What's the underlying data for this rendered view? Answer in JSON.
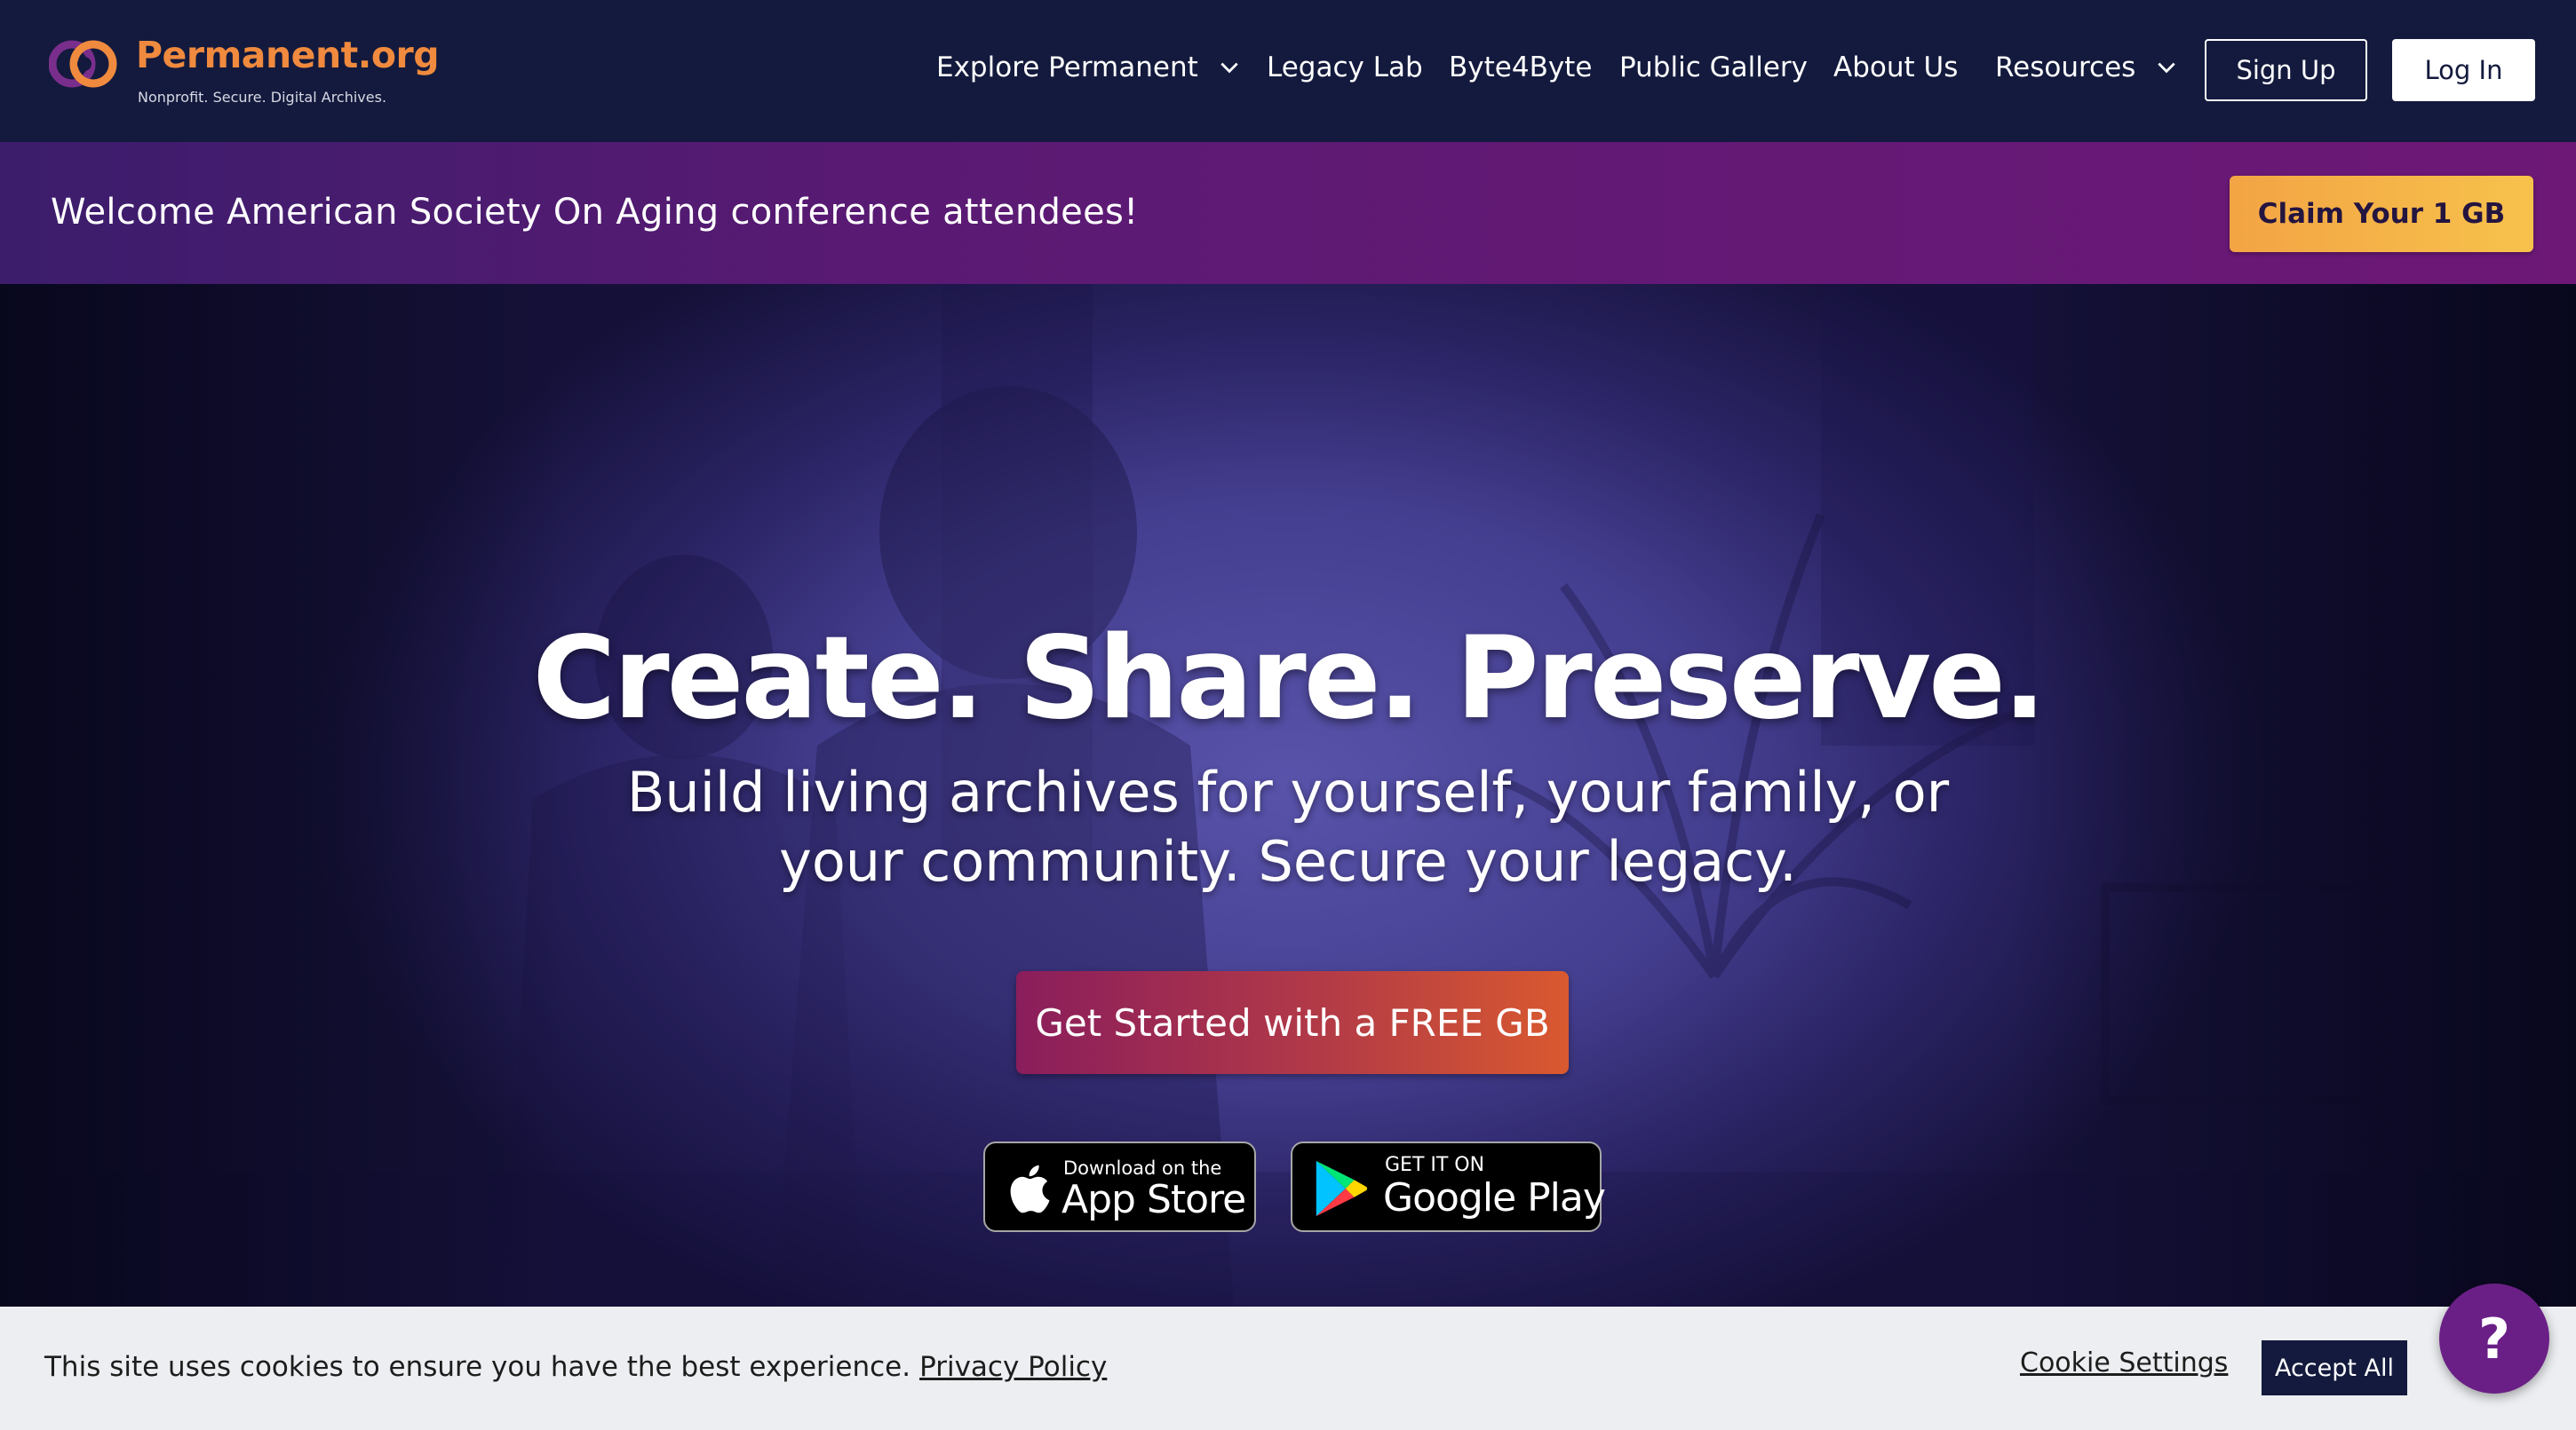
{
  "nav": {
    "logo_name": "Permanent.org",
    "logo_tagline": "Nonprofit. Secure. Digital Archives.",
    "links": [
      {
        "label": "Explore Permanent",
        "has_dropdown": true
      },
      {
        "label": "Legacy Lab",
        "has_dropdown": false
      },
      {
        "label": "Byte4Byte",
        "has_dropdown": false
      },
      {
        "label": "Public Gallery",
        "has_dropdown": false
      },
      {
        "label": "About Us",
        "has_dropdown": false
      },
      {
        "label": "Resources",
        "has_dropdown": true
      }
    ],
    "signup_label": "Sign Up",
    "login_label": "Log In"
  },
  "banner": {
    "text": "Welcome American Society On Aging conference attendees!",
    "cta_label": "Claim Your 1 GB"
  },
  "hero": {
    "title": "Create. Share. Preserve.",
    "subtitle": "Build living archives for yourself, your family, or your community. Secure your legacy.",
    "cta_label": "Get Started with a FREE GB",
    "app_store": {
      "small": "Download on the",
      "big": "App Store"
    },
    "google_play": {
      "small": "GET IT ON",
      "big": "Google Play"
    }
  },
  "cookie": {
    "text": "This site uses cookies to ensure you have the best experience.",
    "privacy_link": "Privacy Policy",
    "settings_label": "Cookie Settings",
    "accept_label": "Accept All"
  },
  "help": {
    "label": "?"
  },
  "colors": {
    "nav_bg": "#131a3d",
    "brand_orange": "#f08a3e",
    "banner_purple": "#5a1a73",
    "claim_gold": "#f5b347",
    "cta_gradient_start": "#8a1d5c",
    "cta_gradient_end": "#d9592f",
    "help_purple": "#6a1f86"
  }
}
